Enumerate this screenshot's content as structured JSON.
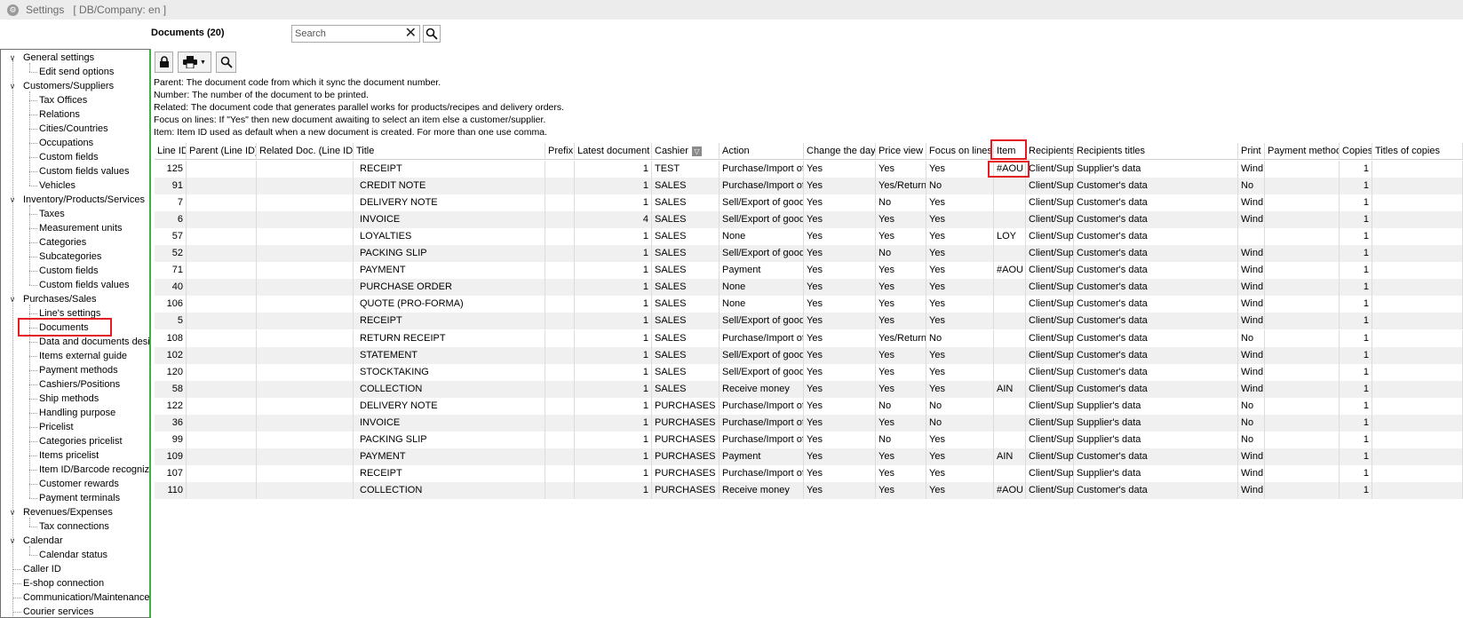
{
  "window": {
    "title": "Settings",
    "context": "[ DB/Company: en ]"
  },
  "header": {
    "title": "Documents (20)",
    "search_placeholder": "Search"
  },
  "toolbar": {
    "lock_icon": "lock-icon",
    "print_icon": "printer-icon",
    "search_icon": "search-icon"
  },
  "notes": [
    "Parent: The document code from which it sync the document number.",
    "Number: The number of the document to be printed.",
    "Related: The document code that generates parallel works for products/recipes and delivery orders.",
    "Focus on lines: If \"Yes\" then new document awaiting to select an item else a customer/supplier.",
    "Item: Item ID used as default when a new document is created. For more than one use comma."
  ],
  "sidebar": {
    "items": [
      {
        "label": "General settings",
        "level": 0,
        "expanded": true
      },
      {
        "label": "Edit send options",
        "level": 1
      },
      {
        "label": "Customers/Suppliers",
        "level": 0,
        "expanded": true
      },
      {
        "label": "Tax Offices",
        "level": 1
      },
      {
        "label": "Relations",
        "level": 1
      },
      {
        "label": "Cities/Countries",
        "level": 1
      },
      {
        "label": "Occupations",
        "level": 1
      },
      {
        "label": "Custom fields",
        "level": 1
      },
      {
        "label": "Custom fields values",
        "level": 1
      },
      {
        "label": "Vehicles",
        "level": 1
      },
      {
        "label": "Inventory/Products/Services",
        "level": 0,
        "expanded": true
      },
      {
        "label": "Taxes",
        "level": 1
      },
      {
        "label": "Measurement units",
        "level": 1
      },
      {
        "label": "Categories",
        "level": 1
      },
      {
        "label": "Subcategories",
        "level": 1
      },
      {
        "label": "Custom fields",
        "level": 1
      },
      {
        "label": "Custom fields values",
        "level": 1
      },
      {
        "label": "Purchases/Sales",
        "level": 0,
        "expanded": true
      },
      {
        "label": "Line's settings",
        "level": 1
      },
      {
        "label": "Documents",
        "level": 1,
        "selected": true
      },
      {
        "label": "Data and documents desi",
        "level": 1
      },
      {
        "label": "Items external guide",
        "level": 1
      },
      {
        "label": "Payment methods",
        "level": 1
      },
      {
        "label": "Cashiers/Positions",
        "level": 1
      },
      {
        "label": "Ship methods",
        "level": 1
      },
      {
        "label": "Handling purpose",
        "level": 1
      },
      {
        "label": "Pricelist",
        "level": 1
      },
      {
        "label": "Categories pricelist",
        "level": 1
      },
      {
        "label": "Items pricelist",
        "level": 1
      },
      {
        "label": "Item ID/Barcode recognize",
        "level": 1
      },
      {
        "label": "Customer rewards",
        "level": 1
      },
      {
        "label": "Payment terminals",
        "level": 1
      },
      {
        "label": "Revenues/Expenses",
        "level": 0,
        "expanded": true
      },
      {
        "label": "Tax connections",
        "level": 1
      },
      {
        "label": "Calendar",
        "level": 0,
        "expanded": true
      },
      {
        "label": "Calendar status",
        "level": 1
      },
      {
        "label": "Caller ID",
        "level": 0
      },
      {
        "label": "E-shop connection",
        "level": 0
      },
      {
        "label": "Communication/Maintenance",
        "level": 0
      },
      {
        "label": "Courier services",
        "level": 0
      }
    ]
  },
  "table": {
    "columns": [
      "Line ID",
      "Parent (Line ID)",
      "Related Doc. (Line ID)",
      "Title",
      "Prefix",
      "Latest document",
      "Cashier",
      "Action",
      "Change the day",
      "Price view",
      "Focus on lines",
      "Item",
      "Recipients",
      "Recipients titles",
      "Print",
      "Payment method",
      "Copies",
      "Titles of copies"
    ],
    "rows": [
      [
        "125",
        "",
        "",
        "RECEIPT",
        "",
        "1",
        "TEST",
        "Purchase/Import of",
        "Yes",
        "Yes",
        "Yes",
        "#AOU",
        "Client/Supp",
        "Supplier's data",
        "Wind",
        "",
        "1",
        ""
      ],
      [
        "91",
        "",
        "",
        "CREDIT NOTE",
        "",
        "1",
        "SALES",
        "Purchase/Import of",
        "Yes",
        "Yes/Return",
        "No",
        "",
        "Client/Supp",
        "Customer's data",
        "No",
        "",
        "1",
        ""
      ],
      [
        "7",
        "",
        "",
        "DELIVERY NOTE",
        "",
        "1",
        "SALES",
        "Sell/Export of good",
        "Yes",
        "No",
        "Yes",
        "",
        "Client/Supp",
        "Customer's data",
        "Wind",
        "",
        "1",
        ""
      ],
      [
        "6",
        "",
        "",
        "INVOICE",
        "",
        "4",
        "SALES",
        "Sell/Export of good",
        "Yes",
        "Yes",
        "Yes",
        "",
        "Client/Supp",
        "Customer's data",
        "Wind",
        "",
        "1",
        ""
      ],
      [
        "57",
        "",
        "",
        "LOYALTIES",
        "",
        "1",
        "SALES",
        "None",
        "Yes",
        "Yes",
        "Yes",
        "LOY",
        "Client/Supp",
        "Customer's data",
        "",
        "",
        "1",
        ""
      ],
      [
        "52",
        "",
        "",
        "PACKING SLIP",
        "",
        "1",
        "SALES",
        "Sell/Export of good",
        "Yes",
        "No",
        "Yes",
        "",
        "Client/Supp",
        "Customer's data",
        "Wind",
        "",
        "1",
        ""
      ],
      [
        "71",
        "",
        "",
        "PAYMENT",
        "",
        "1",
        "SALES",
        "Payment",
        "Yes",
        "Yes",
        "Yes",
        "#AOU",
        "Client/Supp",
        "Customer's data",
        "Wind",
        "",
        "1",
        ""
      ],
      [
        "40",
        "",
        "",
        "PURCHASE ORDER",
        "",
        "1",
        "SALES",
        "None",
        "Yes",
        "Yes",
        "Yes",
        "",
        "Client/Supp",
        "Customer's data",
        "Wind",
        "",
        "1",
        ""
      ],
      [
        "106",
        "",
        "",
        "QUOTE (PRO-FORMA)",
        "",
        "1",
        "SALES",
        "None",
        "Yes",
        "Yes",
        "Yes",
        "",
        "Client/Supp",
        "Customer's data",
        "Wind",
        "",
        "1",
        ""
      ],
      [
        "5",
        "",
        "",
        "RECEIPT",
        "",
        "1",
        "SALES",
        "Sell/Export of good",
        "Yes",
        "Yes",
        "Yes",
        "",
        "Client/Supp",
        "Customer's data",
        "Wind",
        "",
        "1",
        ""
      ],
      [
        "108",
        "",
        "",
        "RETURN RECEIPT",
        "",
        "1",
        "SALES",
        "Purchase/Import of",
        "Yes",
        "Yes/Return",
        "No",
        "",
        "Client/Supp",
        "Customer's data",
        "No",
        "",
        "1",
        ""
      ],
      [
        "102",
        "",
        "",
        "STATEMENT",
        "",
        "1",
        "SALES",
        "Sell/Export of good",
        "Yes",
        "Yes",
        "Yes",
        "",
        "Client/Supp",
        "Customer's data",
        "Wind",
        "",
        "1",
        ""
      ],
      [
        "120",
        "",
        "",
        "STOCKTAKING",
        "",
        "1",
        "SALES",
        "Sell/Export of good",
        "Yes",
        "Yes",
        "Yes",
        "",
        "Client/Supp",
        "Customer's data",
        "Wind",
        "",
        "1",
        ""
      ],
      [
        "58",
        "",
        "",
        "COLLECTION",
        "",
        "1",
        "SALES",
        "Receive money",
        "Yes",
        "Yes",
        "Yes",
        "AIN",
        "Client/Supp",
        "Customer's data",
        "Wind",
        "",
        "1",
        ""
      ],
      [
        "122",
        "",
        "",
        "DELIVERY NOTE",
        "",
        "1",
        "PURCHASES",
        "Purchase/Import of",
        "Yes",
        "No",
        "No",
        "",
        "Client/Supp",
        "Supplier's data",
        "No",
        "",
        "1",
        ""
      ],
      [
        "36",
        "",
        "",
        "INVOICE",
        "",
        "1",
        "PURCHASES",
        "Purchase/Import of",
        "Yes",
        "Yes",
        "No",
        "",
        "Client/Supp",
        "Supplier's data",
        "No",
        "",
        "1",
        ""
      ],
      [
        "99",
        "",
        "",
        "PACKING SLIP",
        "",
        "1",
        "PURCHASES",
        "Purchase/Import of",
        "Yes",
        "No",
        "Yes",
        "",
        "Client/Supp",
        "Supplier's data",
        "No",
        "",
        "1",
        ""
      ],
      [
        "109",
        "",
        "",
        "PAYMENT",
        "",
        "1",
        "PURCHASES",
        "Payment",
        "Yes",
        "Yes",
        "Yes",
        "AIN",
        "Client/Supp",
        "Customer's data",
        "Wind",
        "",
        "1",
        ""
      ],
      [
        "107",
        "",
        "",
        "RECEIPT",
        "",
        "1",
        "PURCHASES",
        "Purchase/Import of",
        "Yes",
        "Yes",
        "Yes",
        "",
        "Client/Supp",
        "Supplier's data",
        "Wind",
        "",
        "1",
        ""
      ],
      [
        "110",
        "",
        "",
        "COLLECTION",
        "",
        "1",
        "PURCHASES",
        "Receive money",
        "Yes",
        "Yes",
        "Yes",
        "#AOU",
        "Client/Supp",
        "Customer's data",
        "Wind",
        "",
        "1",
        ""
      ]
    ]
  },
  "colors": {
    "highlight": "#e41b23",
    "sidebar_border": "#3cb043",
    "row_alt": "#f0f0f0"
  }
}
